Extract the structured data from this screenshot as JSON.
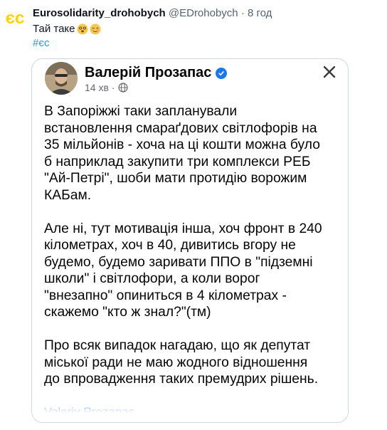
{
  "post": {
    "author_name": "Eurosolidarity_drohobych",
    "author_handle": "@EDrohobych",
    "separator": "·",
    "time": "8 год",
    "text": "Тай таке",
    "emojis": [
      "dizzy-face-emoji",
      "relieved-face-emoji"
    ],
    "hashtag": "#єс",
    "logo_text": "єс",
    "logo_color": "#ffd200",
    "accent_color": "#1d9bf0"
  },
  "fb_card": {
    "author_name": "Валерій Прозапас",
    "time": "14 хв",
    "paragraphs": [
      "В Запоріжжі таки запланували\nвстановлення смараґдових світлофорів на\n35 мільйонів - хоча на ці кошти можна було\nб наприклад закупити три комплекси РЕБ\n\"Ай-Петрі\", шоби мати протидію ворожим\nКАБам.",
      "Але ні, тут мотивація інша, хоч фронт в 240\nкілометрах, хоч в 40, дивитись вгору не\nбудемо,   будемо заривати ППО в \"підземні\nшколи\" і світлофори, а коли ворог\n\"внезапно\" опиниться в 4 кілометрах -\nскажемо \"кто ж знал?\"(тм)",
      "Про всяк випадок нагадаю, що як депутат\nміської ради не маю жодного відношення\nдо впровадження таких премудрих рішень."
    ],
    "footer_link": "Valeriy Prozapas",
    "verified_color": "#1877f2"
  }
}
